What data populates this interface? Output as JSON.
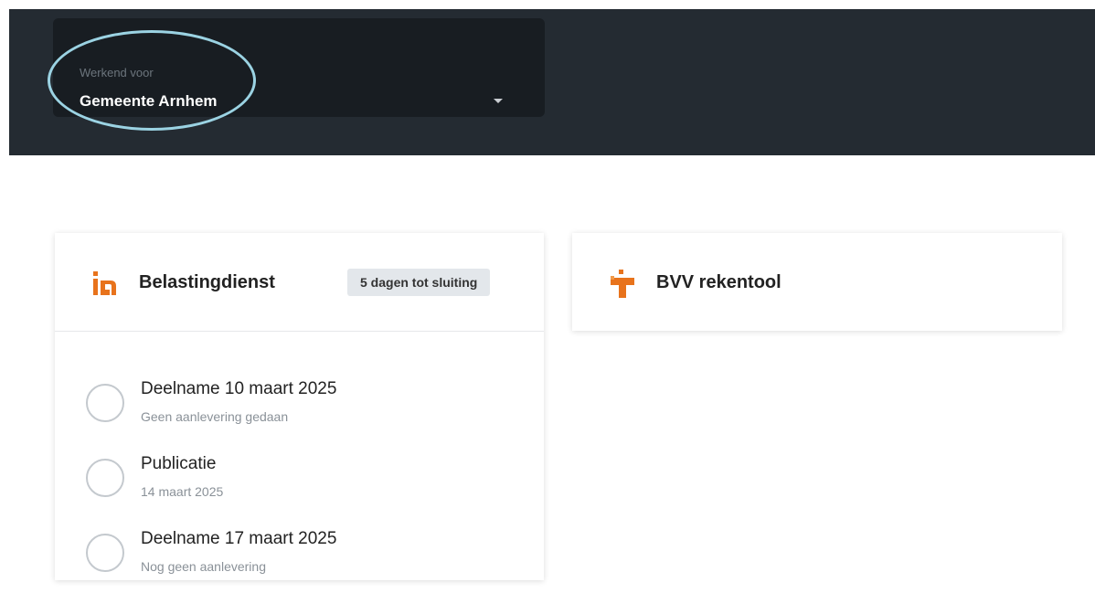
{
  "header": {
    "org_selector": {
      "label": "Werkend voor",
      "value": "Gemeente Arnhem"
    }
  },
  "cards": {
    "belastingdienst": {
      "title": "Belastingdienst",
      "badge": "5 dagen tot sluiting",
      "steps": [
        {
          "title": "Deelname 10 maart 2025",
          "subtitle": "Geen aanlevering gedaan"
        },
        {
          "title": "Publicatie",
          "subtitle": "14 maart 2025"
        },
        {
          "title": "Deelname 17 maart 2025",
          "subtitle": "Nog geen aanlevering"
        }
      ]
    },
    "bvv": {
      "title": "BVV rekentool"
    }
  },
  "colors": {
    "header_bg": "#242b32",
    "selector_bg": "#181d22",
    "accent_orange": "#e8731c",
    "highlight": "#9bd3e3"
  },
  "icons": {
    "belastingdienst_logo": "belastingdienst-logo-icon",
    "bvv_logo": "bvv-plus-logo-icon",
    "dropdown": "caret-down-icon"
  }
}
